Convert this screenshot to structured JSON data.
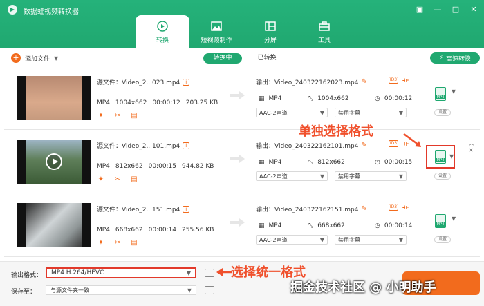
{
  "app": {
    "title": "数据蛙视频转换器",
    "window_controls": [
      "feedback-icon",
      "minimize-icon",
      "maximize-icon",
      "close-icon"
    ]
  },
  "main_tabs": [
    {
      "label": "转换",
      "icon": "convert-icon",
      "active": true
    },
    {
      "label": "短视频制作",
      "icon": "image-icon",
      "active": false
    },
    {
      "label": "分屏",
      "icon": "split-screen-icon",
      "active": false
    },
    {
      "label": "工具",
      "icon": "toolbox-icon",
      "active": false
    }
  ],
  "toolbar": {
    "add_file": "添加文件",
    "subtabs": [
      "转换中",
      "已转换"
    ],
    "high_speed": "高速转换"
  },
  "files": [
    {
      "source": "源文件：Video_2...023.mp4",
      "format": "MP4",
      "resolution": "1004x662",
      "duration": "00:00:12",
      "size": "203.25 KB",
      "output": "输出：Video_240322162023.mp4",
      "out_format": "MP4",
      "out_resolution": "1004x662",
      "out_duration": "00:00:12",
      "audio": "AAC-2声道",
      "subtitle": "禁用字幕",
      "settings": "设置"
    },
    {
      "source": "源文件：Video_2...101.mp4",
      "format": "MP4",
      "resolution": "812x662",
      "duration": "00:00:15",
      "size": "944.82 KB",
      "output": "输出：Video_240322162101.mp4",
      "out_format": "MP4",
      "out_resolution": "812x662",
      "out_duration": "00:00:15",
      "audio": "AAC-2声道",
      "subtitle": "禁用字幕",
      "settings": "设置"
    },
    {
      "source": "源文件：Video_2...151.mp4",
      "format": "MP4",
      "resolution": "668x662",
      "duration": "00:00:14",
      "size": "255.56 KB",
      "output": "输出：Video_240322162151.mp4",
      "out_format": "MP4",
      "out_resolution": "668x662",
      "out_duration": "00:00:14",
      "audio": "AAC-2声道",
      "subtitle": "禁用字幕",
      "settings": "设置"
    }
  ],
  "bottom": {
    "output_format_label": "输出格式：",
    "output_format_value": "MP4 H.264/HEVC",
    "save_to_label": "保存至：",
    "save_to_value": "与源文件夹一致"
  },
  "annotations": {
    "single_format": "单独选择格式",
    "unified_format": "选择统一格式"
  },
  "watermark": "掘金技术社区 @ 小明助手",
  "colors": {
    "brand_green": "#20a870",
    "accent_orange": "#f26b1d",
    "highlight_red": "#e2392a"
  }
}
